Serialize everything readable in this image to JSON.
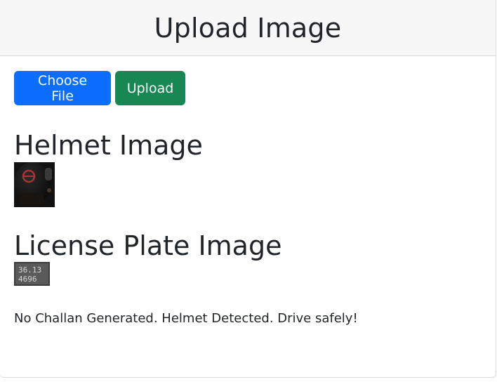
{
  "header": {
    "title": "Upload Image"
  },
  "controls": {
    "choose_file_label": "Choose File",
    "upload_label": "Upload",
    "choose_file_color": "#0d6efd",
    "upload_color": "#198754"
  },
  "helmet_section": {
    "heading": "Helmet Image"
  },
  "plate_section": {
    "heading": "License Plate Image",
    "plate_text": [
      "36.13",
      "4696"
    ]
  },
  "result": {
    "message": "No Challan Generated. Helmet Detected. Drive safely!"
  }
}
